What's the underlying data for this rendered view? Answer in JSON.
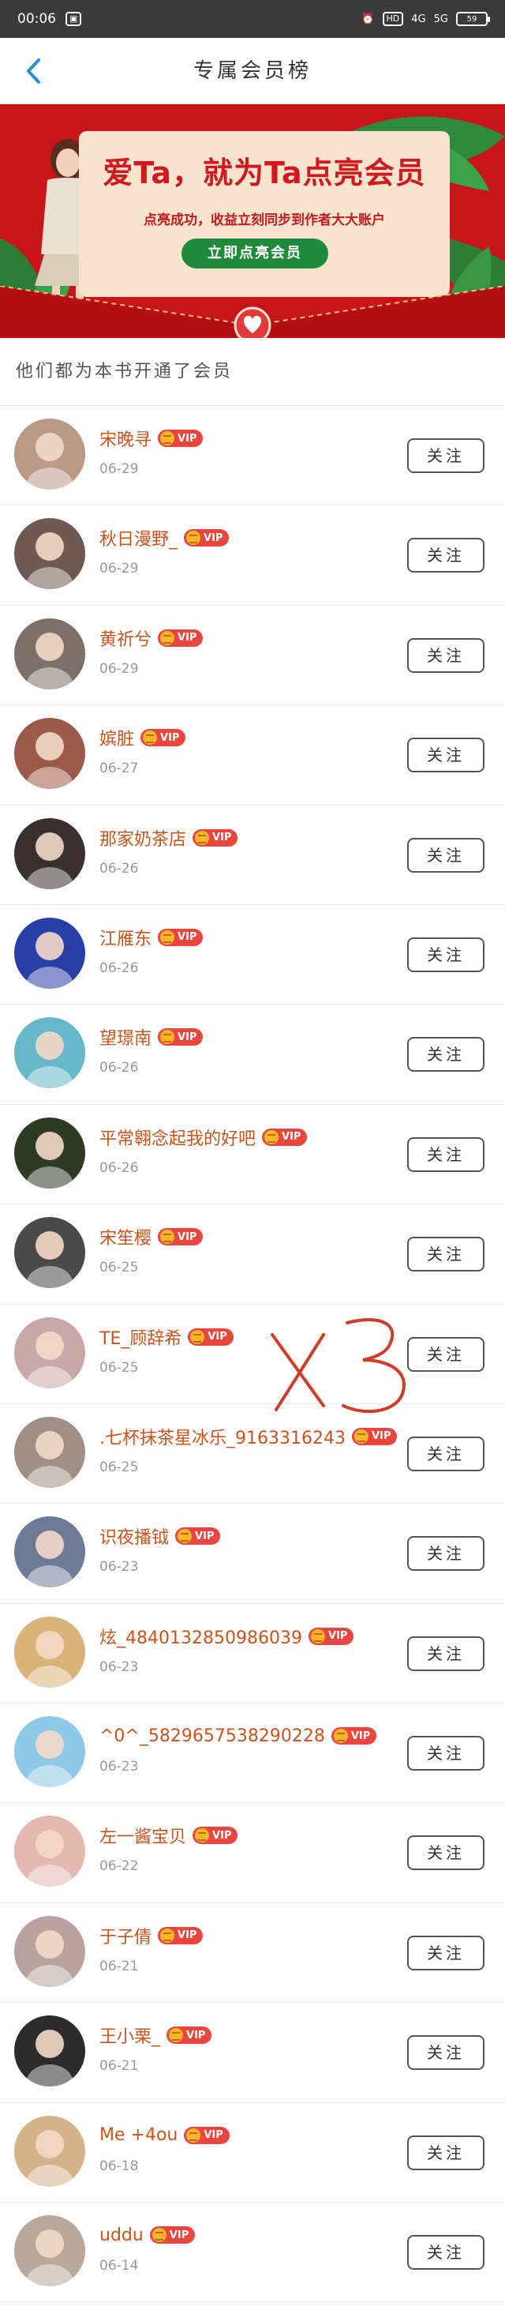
{
  "status_bar": {
    "time": "00:06",
    "left_icon": "notification-icon",
    "hd": "HD",
    "signal_1": "4G",
    "signal_2": "5G",
    "battery": "59"
  },
  "nav": {
    "title": "专属会员榜",
    "back_icon": "chevron-left-icon"
  },
  "banner": {
    "title": "爱Ta，就为Ta点亮会员",
    "subtitle": "点亮成功，收益立刻同步到作者大大账户",
    "button_label": "立即点亮会员",
    "colors": {
      "background": "#c8141b",
      "card": "#f7e4cf",
      "button": "#1f8a3b"
    }
  },
  "section_header": "他们都为本书开通了会员",
  "vip_label": "VIP",
  "follow_label": "关注",
  "members": [
    {
      "name": "宋晚寻",
      "date": "06-29",
      "avatar_color": "#b89a86"
    },
    {
      "name": "秋日漫野_",
      "date": "06-29",
      "avatar_color": "#6e5a52"
    },
    {
      "name": "黄祈兮",
      "date": "06-29",
      "avatar_color": "#7c7068"
    },
    {
      "name": "嫔脏",
      "date": "06-27",
      "avatar_color": "#9c5a4a"
    },
    {
      "name": "那家奶茶店",
      "date": "06-26",
      "avatar_color": "#3a3030"
    },
    {
      "name": "江雁东",
      "date": "06-26",
      "avatar_color": "#2a3ea8"
    },
    {
      "name": "望璟南",
      "date": "06-26",
      "avatar_color": "#66b7c9"
    },
    {
      "name": "平常翱念起我的好吧",
      "date": "06-26",
      "avatar_color": "#2f3a22"
    },
    {
      "name": "宋笙樱",
      "date": "06-25",
      "avatar_color": "#4a4a4a"
    },
    {
      "name": "TE_顾辞希",
      "date": "06-25",
      "avatar_color": "#c9a8a8"
    },
    {
      "name": ".七杯抹茶星冰乐_9163316243",
      "date": "06-25",
      "avatar_color": "#a08f84"
    },
    {
      "name": "识夜播钺",
      "date": "06-23",
      "avatar_color": "#6f7a96"
    },
    {
      "name": "炫_4840132850986039",
      "date": "06-23",
      "avatar_color": "#d9b37a"
    },
    {
      "name": "^0^_5829657538290228",
      "date": "06-23",
      "avatar_color": "#8fc9e8"
    },
    {
      "name": "左一酱宝贝",
      "date": "06-22",
      "avatar_color": "#e2b8b0"
    },
    {
      "name": "于子倩",
      "date": "06-21",
      "avatar_color": "#b8a3a0"
    },
    {
      "name": "王小栗_",
      "date": "06-21",
      "avatar_color": "#2c2c2c"
    },
    {
      "name": "Me +4ou",
      "date": "06-18",
      "avatar_color": "#d4b38a"
    },
    {
      "name": "uddu",
      "date": "06-14",
      "avatar_color": "#b9a89c"
    }
  ],
  "annotation": "X3"
}
